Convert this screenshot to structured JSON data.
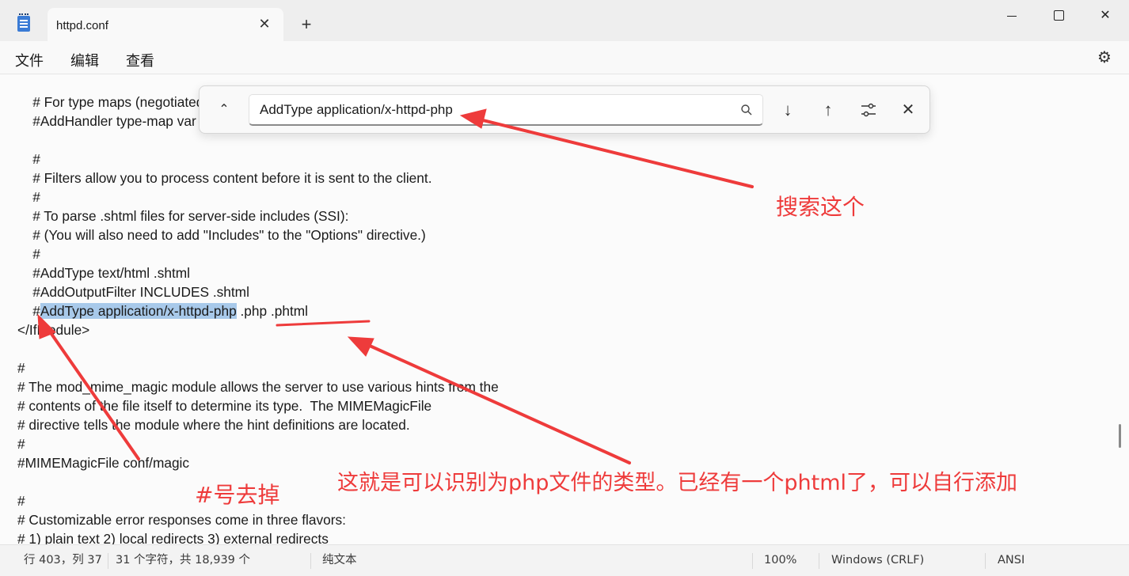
{
  "window": {
    "tab_title": "httpd.conf",
    "close_tab_glyph": "✕",
    "new_tab_glyph": "+",
    "close_glyph": "✕"
  },
  "menu": {
    "file": "文件",
    "edit": "编辑",
    "view": "查看",
    "settings_icon": "gear-icon"
  },
  "find": {
    "query": "AddType application/x-httpd-php",
    "toggle_glyph": "⌃",
    "down_glyph": "↓",
    "up_glyph": "↑",
    "options_icon": "sliders-icon",
    "close_glyph": "✕"
  },
  "editor": {
    "lines": [
      "    # For type maps (negotiated resources):",
      "    #AddHandler type-map var",
      "",
      "    #",
      "    # Filters allow you to process content before it is sent to the client.",
      "    #",
      "    # To parse .shtml files for server-side includes (SSI):",
      "    # (You will also need to add \"Includes\" to the \"Options\" directive.)",
      "    #",
      "    #AddType text/html .shtml",
      "    #AddOutputFilter INCLUDES .shtml",
      "",
      "</IfModule>",
      "",
      "#",
      "# The mod_mime_magic module allows the server to use various hints from the",
      "# contents of the file itself to determine its type.  The MIMEMagicFile",
      "# directive tells the module where the hint definitions are located.",
      "#",
      "#MIMEMagicFile conf/magic",
      "",
      "#",
      "# Customizable error responses come in three flavors:",
      "# 1) plain text 2) local redirects 3) external redirects"
    ],
    "match_line": {
      "prefix": "    #",
      "highlight": "AddType application/x-httpd-php",
      "suffix": " .php .phtml"
    }
  },
  "status": {
    "position": "行 403，列 37",
    "chars": "31 个字符，共 18,939 个",
    "format": "纯文本",
    "zoom": "100%",
    "line_ending": "Windows (CRLF)",
    "encoding": "ANSI"
  },
  "annotations": {
    "search_this": "搜索这个",
    "remove_hash": "#号去掉",
    "explanation": "这就是可以识别为php文件的类型。已经有一个phtml了，可以自行添加",
    "color": "#ee3b3b"
  }
}
